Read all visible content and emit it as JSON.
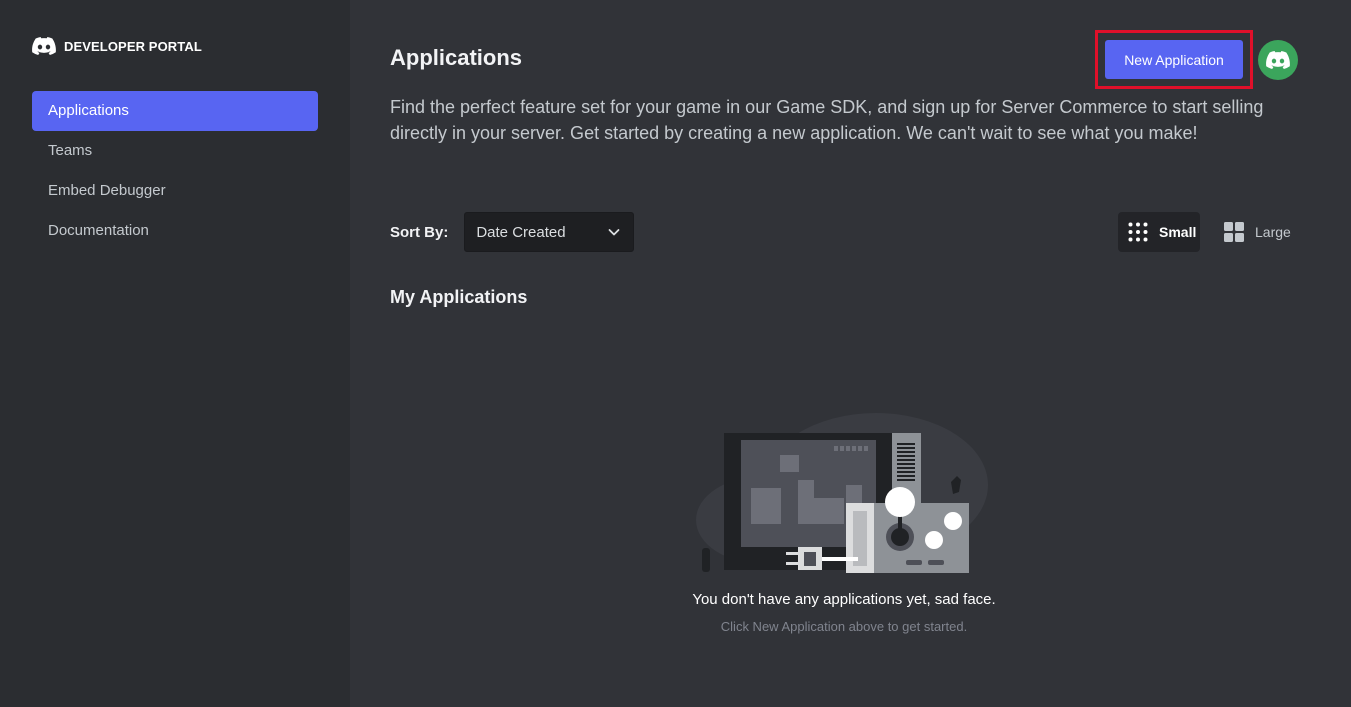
{
  "sidebar": {
    "brand": "DEVELOPER PORTAL",
    "brand_icon": "discord-logo-icon",
    "items": [
      {
        "label": "Applications",
        "active": true
      },
      {
        "label": "Teams",
        "active": false
      },
      {
        "label": "Embed Debugger",
        "active": false
      },
      {
        "label": "Documentation",
        "active": false
      }
    ]
  },
  "header": {
    "title": "Applications",
    "new_app_label": "New Application",
    "avatar_icon": "discord-avatar-icon"
  },
  "description": "Find the perfect feature set for your game in our Game SDK, and sign up for Server Commerce to start selling directly in your server. Get started by creating a new application. We can't wait to see what you make!",
  "sort": {
    "label": "Sort By:",
    "value": "Date Created"
  },
  "view_toggle": {
    "small_label": "Small",
    "large_label": "Large",
    "selected": "Small"
  },
  "section": {
    "title": "My Applications"
  },
  "empty_state": {
    "title": "You don't have any applications yet, sad face.",
    "subtitle": "Click New Application above to get started."
  },
  "colors": {
    "accent": "#5865f2",
    "highlight_border": "#e0102a",
    "avatar": "#3ba55c",
    "background": "#313338",
    "sidebar": "#2b2d31"
  }
}
